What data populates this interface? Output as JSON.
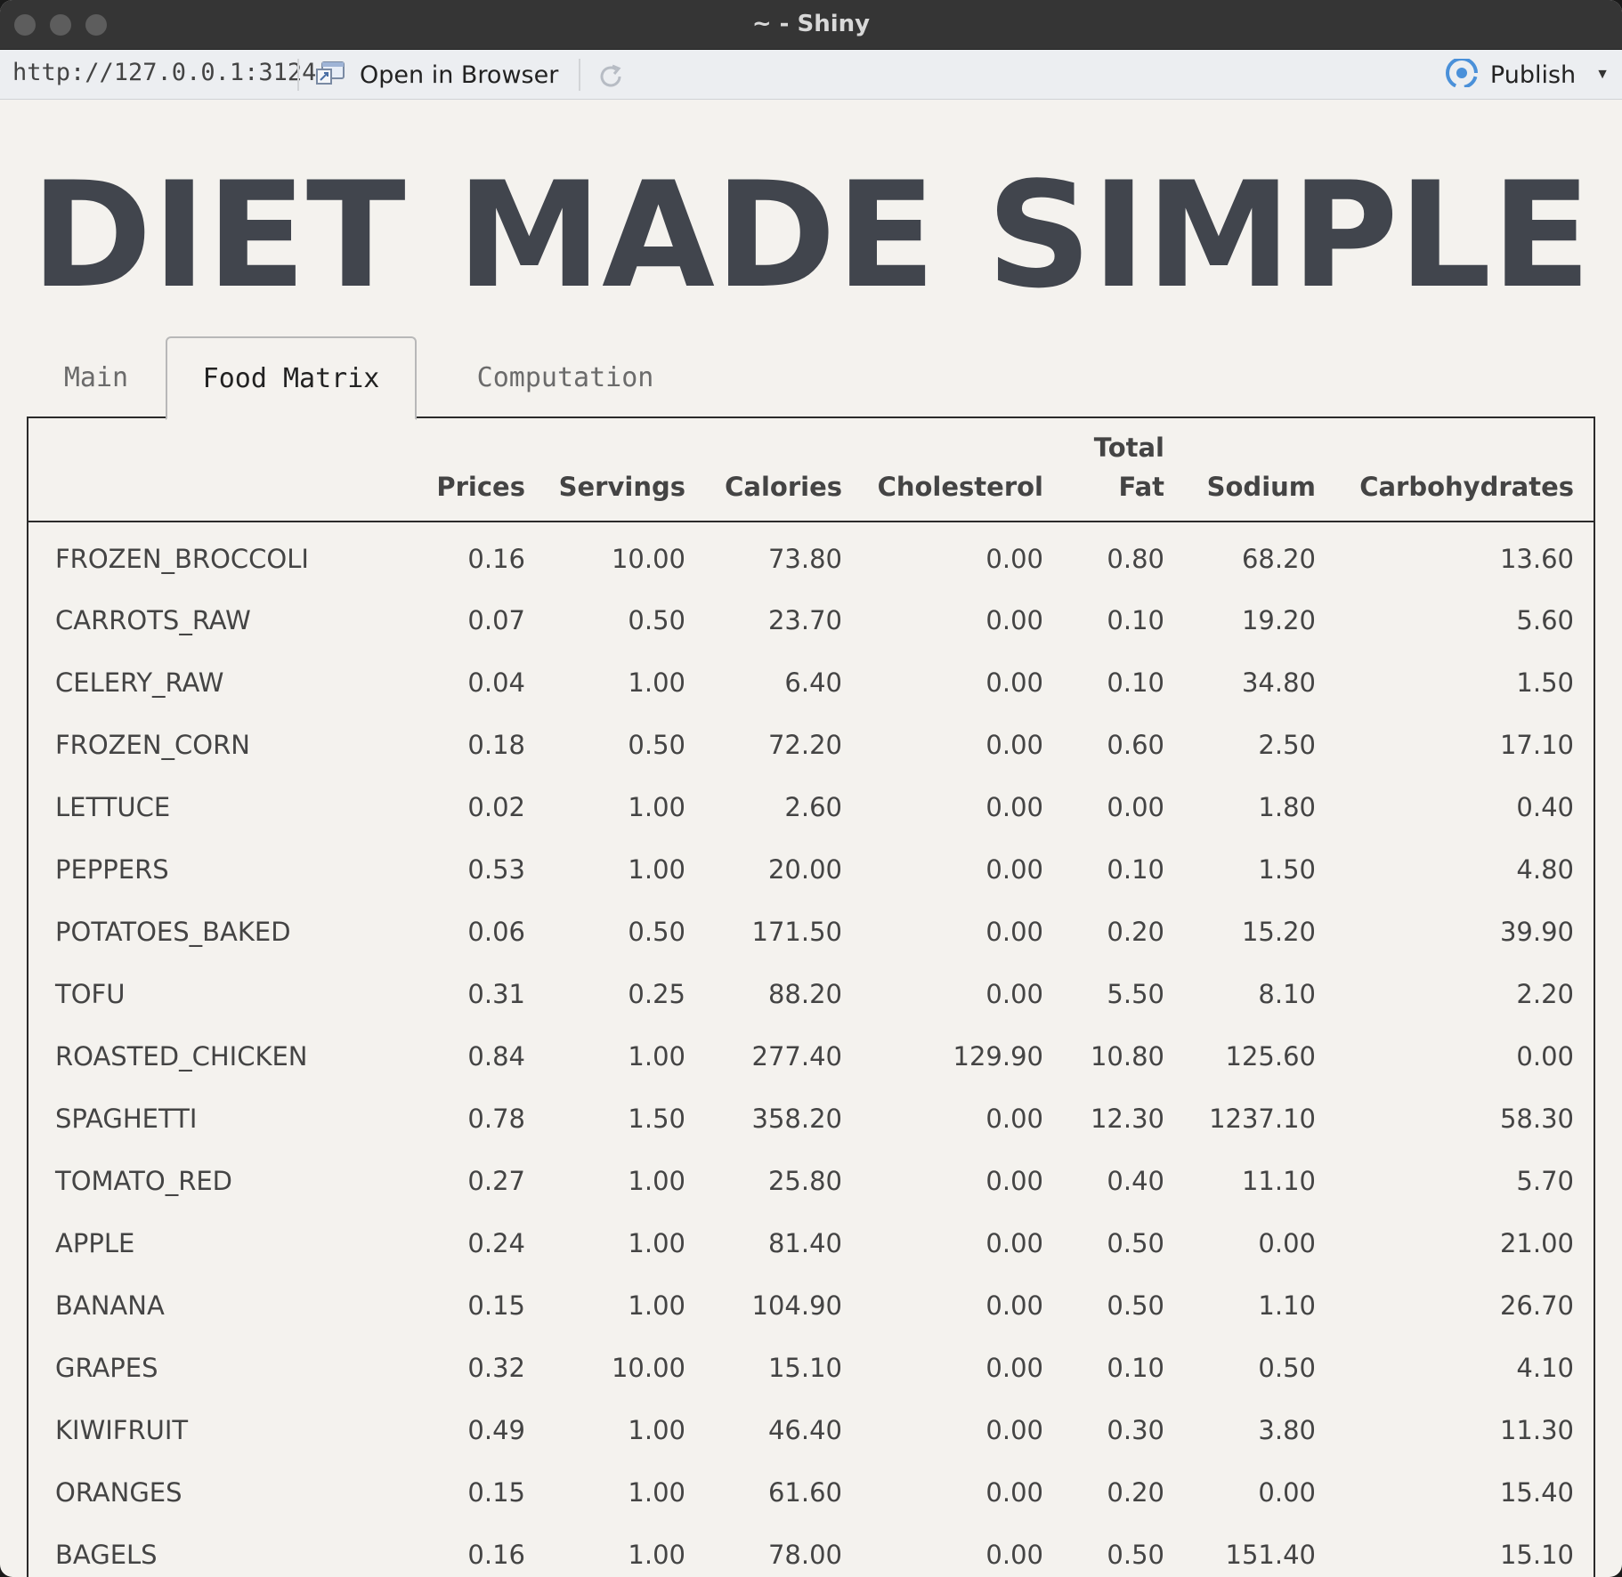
{
  "window": {
    "title": "~ - Shiny"
  },
  "toolbar": {
    "url": "http://127.0.0.1:3124",
    "open_in_browser": "Open in Browser",
    "publish": "Publish"
  },
  "app": {
    "title": "DIET MADE SIMPLE",
    "tabs": [
      "Main",
      "Food Matrix",
      "Computation"
    ]
  },
  "table": {
    "headers": [
      "",
      "Prices",
      "Servings",
      "Calories",
      "Cholesterol",
      "Total Fat",
      "Sodium",
      "Carbohydrates"
    ],
    "rows": [
      [
        "FROZEN_BROCCOLI",
        "0.16",
        "10.00",
        "73.80",
        "0.00",
        "0.80",
        "68.20",
        "13.60"
      ],
      [
        "CARROTS_RAW",
        "0.07",
        "0.50",
        "23.70",
        "0.00",
        "0.10",
        "19.20",
        "5.60"
      ],
      [
        "CELERY_RAW",
        "0.04",
        "1.00",
        "6.40",
        "0.00",
        "0.10",
        "34.80",
        "1.50"
      ],
      [
        "FROZEN_CORN",
        "0.18",
        "0.50",
        "72.20",
        "0.00",
        "0.60",
        "2.50",
        "17.10"
      ],
      [
        "LETTUCE",
        "0.02",
        "1.00",
        "2.60",
        "0.00",
        "0.00",
        "1.80",
        "0.40"
      ],
      [
        "PEPPERS",
        "0.53",
        "1.00",
        "20.00",
        "0.00",
        "0.10",
        "1.50",
        "4.80"
      ],
      [
        "POTATOES_BAKED",
        "0.06",
        "0.50",
        "171.50",
        "0.00",
        "0.20",
        "15.20",
        "39.90"
      ],
      [
        "TOFU",
        "0.31",
        "0.25",
        "88.20",
        "0.00",
        "5.50",
        "8.10",
        "2.20"
      ],
      [
        "ROASTED_CHICKEN",
        "0.84",
        "1.00",
        "277.40",
        "129.90",
        "10.80",
        "125.60",
        "0.00"
      ],
      [
        "SPAGHETTI",
        "0.78",
        "1.50",
        "358.20",
        "0.00",
        "12.30",
        "1237.10",
        "58.30"
      ],
      [
        "TOMATO_RED",
        "0.27",
        "1.00",
        "25.80",
        "0.00",
        "0.40",
        "11.10",
        "5.70"
      ],
      [
        "APPLE",
        "0.24",
        "1.00",
        "81.40",
        "0.00",
        "0.50",
        "0.00",
        "21.00"
      ],
      [
        "BANANA",
        "0.15",
        "1.00",
        "104.90",
        "0.00",
        "0.50",
        "1.10",
        "26.70"
      ],
      [
        "GRAPES",
        "0.32",
        "10.00",
        "15.10",
        "0.00",
        "0.10",
        "0.50",
        "4.10"
      ],
      [
        "KIWIFRUIT",
        "0.49",
        "1.00",
        "46.40",
        "0.00",
        "0.30",
        "3.80",
        "11.30"
      ],
      [
        "ORANGES",
        "0.15",
        "1.00",
        "61.60",
        "0.00",
        "0.20",
        "0.00",
        "15.40"
      ],
      [
        "BAGELS",
        "0.16",
        "1.00",
        "78.00",
        "0.00",
        "0.50",
        "151.40",
        "15.10"
      ]
    ]
  }
}
